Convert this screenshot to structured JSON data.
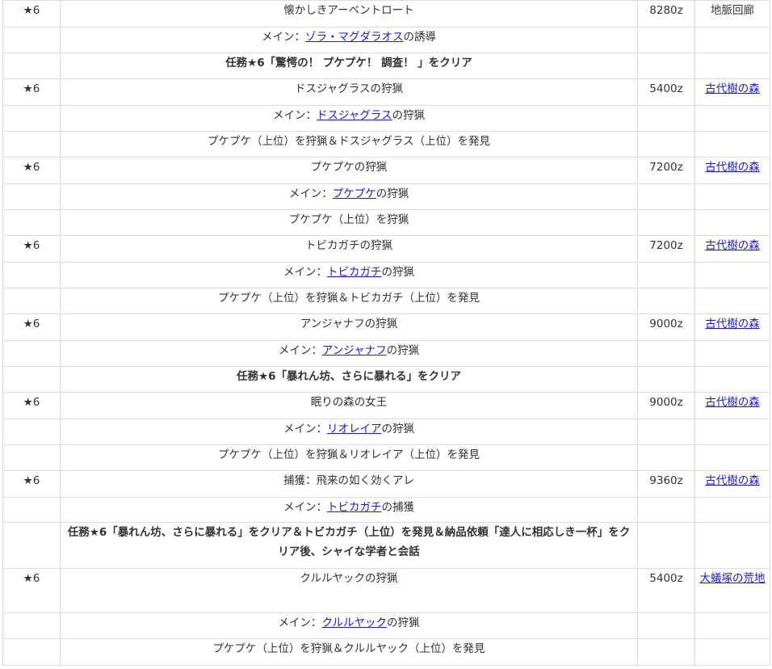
{
  "quests": [
    {
      "rank": "★6",
      "name": "懐かしきアーベントロート",
      "reward": "8280z",
      "area": {
        "text": "地脈回廊",
        "link": false
      },
      "main": {
        "label": "メイン：",
        "target": "ゾラ・マグダラオス",
        "suffix": "の誘導"
      },
      "condition": "任務★6「驚愕の！ プケプケ！ 調査！ 」をクリア",
      "condition_bold": true
    },
    {
      "rank": "★6",
      "name": "ドスジャグラスの狩猟",
      "reward": "5400z",
      "area": {
        "text": "古代樹の森",
        "link": true
      },
      "main": {
        "label": "メイン：",
        "target": "ドスジャグラス",
        "suffix": "の狩猟"
      },
      "condition": "プケプケ（上位）を狩猟＆ドスジャグラス（上位）を発見",
      "condition_bold": false
    },
    {
      "rank": "★6",
      "name": "プケプケの狩猟",
      "reward": "7200z",
      "area": {
        "text": "古代樹の森",
        "link": true
      },
      "main": {
        "label": "メイン：",
        "target": "プケプケ",
        "suffix": "の狩猟"
      },
      "condition": "プケプケ（上位）を狩猟",
      "condition_bold": false
    },
    {
      "rank": "★6",
      "name": "トビカガチの狩猟",
      "reward": "7200z",
      "area": {
        "text": "古代樹の森",
        "link": true
      },
      "main": {
        "label": "メイン：",
        "target": "トビカガチ",
        "suffix": "の狩猟"
      },
      "condition": "プケプケ（上位）を狩猟＆トビカガチ（上位）を発見",
      "condition_bold": false
    },
    {
      "rank": "★6",
      "name": "アンジャナフの狩猟",
      "reward": "9000z",
      "area": {
        "text": "古代樹の森",
        "link": true
      },
      "main": {
        "label": "メイン：",
        "target": "アンジャナフ",
        "suffix": "の狩猟"
      },
      "condition": "任務★6「暴れん坊、さらに暴れる」をクリア",
      "condition_bold": true
    },
    {
      "rank": "★6",
      "name": "眠りの森の女王",
      "reward": "9000z",
      "area": {
        "text": "古代樹の森",
        "link": true
      },
      "main": {
        "label": "メイン：",
        "target": "リオレイア",
        "suffix": "の狩猟"
      },
      "condition": "プケプケ（上位）を狩猟＆リオレイア（上位）を発見",
      "condition_bold": false
    },
    {
      "rank": "★6",
      "name": "捕獲：飛来の如く効くアレ",
      "reward": "9360z",
      "area": {
        "text": "古代樹の森",
        "link": true
      },
      "main": {
        "label": "メイン：",
        "target": "トビカガチ",
        "suffix": "の捕獲"
      },
      "condition": "任務★6「暴れん坊、さらに暴れる」をクリア＆トビカガチ（上位）を発見＆納品依頼「達人に相応しき一杯」をクリア後、シャイな学者と会話",
      "condition_bold": true
    },
    {
      "rank": "★6",
      "name": "クルルヤックの狩猟",
      "reward": "5400z",
      "area": {
        "text": "大蟻塚の荒地",
        "link": true
      },
      "main": {
        "label": "メイン：",
        "target": "クルルヤック",
        "suffix": "の狩猟"
      },
      "condition": "プケプケ（上位）を狩猟＆クルルヤック（上位）を発見",
      "condition_bold": false
    }
  ]
}
